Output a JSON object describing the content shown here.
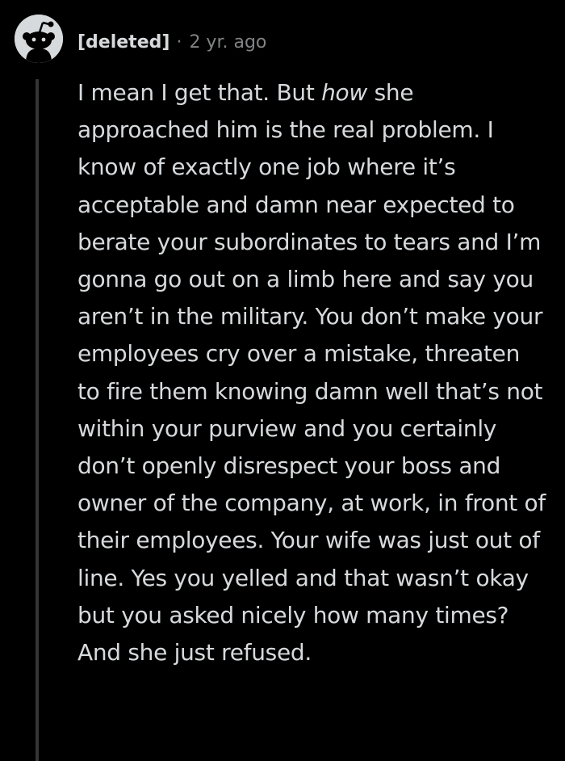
{
  "colors": {
    "background": "#000000",
    "text": "#d7dadc",
    "meta": "#818384",
    "thread_line": "#343536",
    "avatar_bg": "#d7dadc"
  },
  "comment": {
    "avatar_icon": "reddit-snoo-icon",
    "author": "[deleted]",
    "separator": "·",
    "timestamp": "2 yr. ago",
    "body": {
      "part1": "I mean I get that. But ",
      "emphasis": "how",
      "part2": " she approached him is the real problem. I know of exactly one job where it’s acceptable and damn near expected to berate your subordinates to tears and I’m gonna go out on a limb here and say you aren’t in the military. You don’t make your employees cry over a mistake, threaten to fire them knowing damn well that’s not within your purview and you certainly don’t openly disrespect your boss and owner of the company, at work, in front of their employees. Your wife was just out of line. Yes you yelled and that wasn’t okay but you asked nicely how many times? And she just refused."
    }
  }
}
